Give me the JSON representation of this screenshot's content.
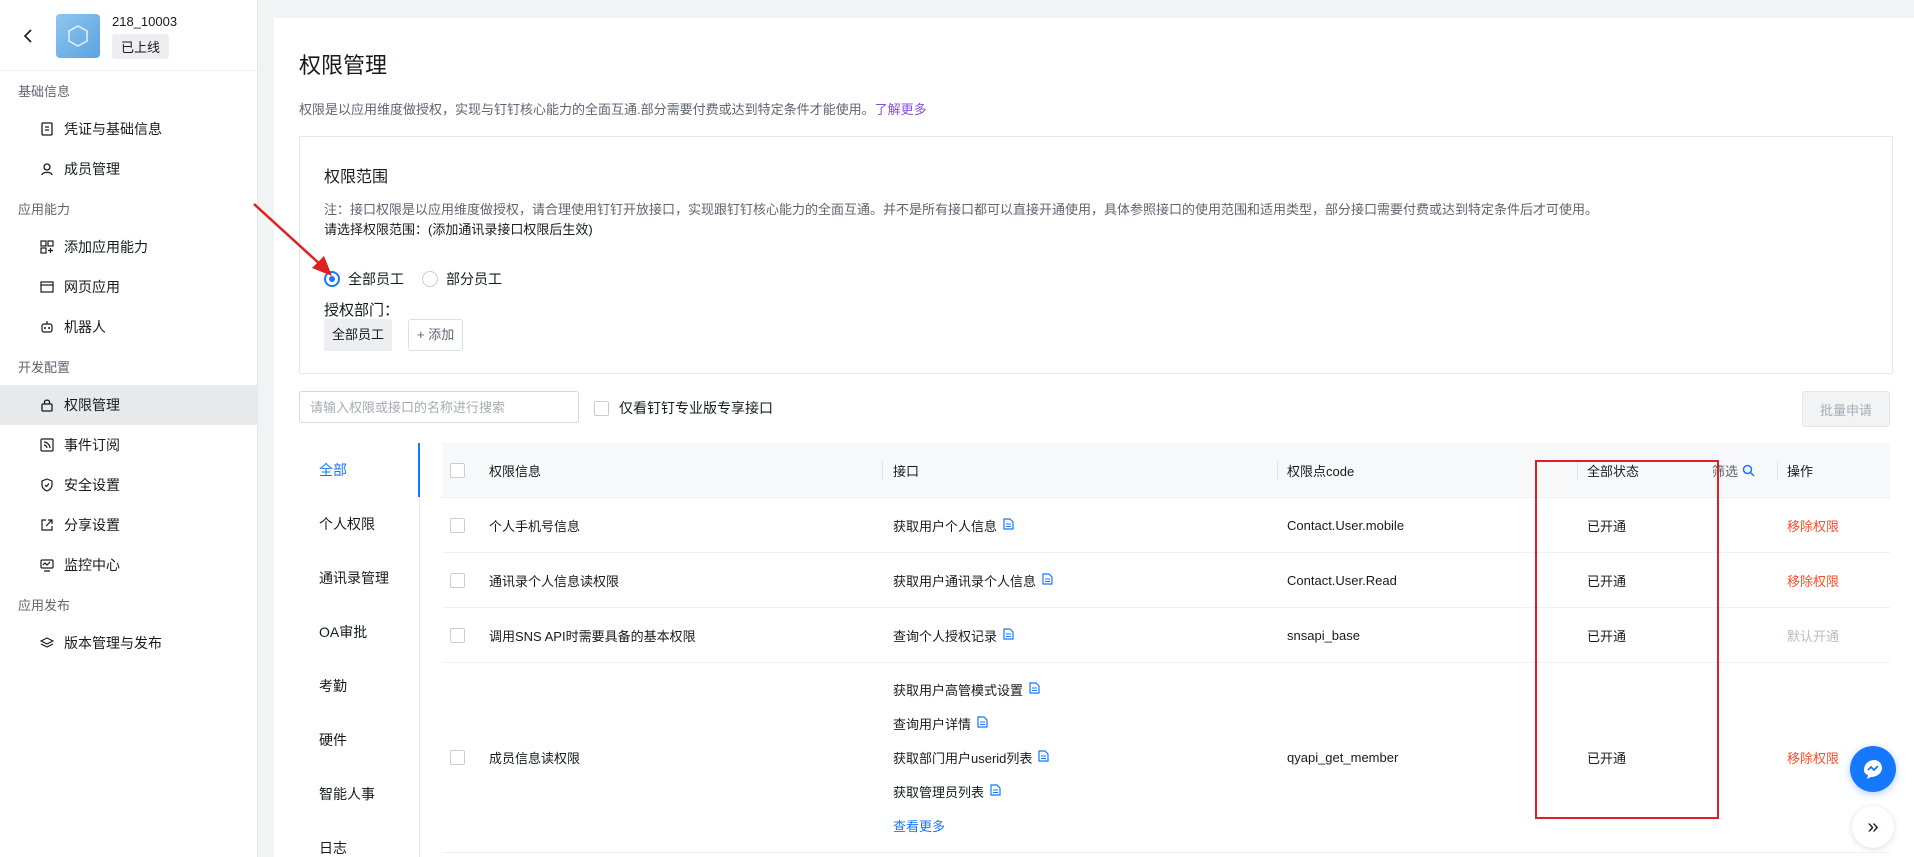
{
  "app": {
    "name": "218_10003",
    "status": "已上线"
  },
  "sidebar": {
    "groups": [
      {
        "title": "基础信息",
        "items": [
          {
            "label": "凭证与基础信息",
            "icon": "credential-icon"
          },
          {
            "label": "成员管理",
            "icon": "user-icon"
          }
        ]
      },
      {
        "title": "应用能力",
        "items": [
          {
            "label": "添加应用能力",
            "icon": "grid-plus-icon"
          },
          {
            "label": "网页应用",
            "icon": "browser-icon"
          },
          {
            "label": "机器人",
            "icon": "robot-icon"
          }
        ]
      },
      {
        "title": "开发配置",
        "items": [
          {
            "label": "权限管理",
            "icon": "lock-icon",
            "active": true
          },
          {
            "label": "事件订阅",
            "icon": "rss-icon"
          },
          {
            "label": "安全设置",
            "icon": "shield-icon"
          },
          {
            "label": "分享设置",
            "icon": "share-icon"
          },
          {
            "label": "监控中心",
            "icon": "monitor-icon"
          }
        ]
      },
      {
        "title": "应用发布",
        "items": [
          {
            "label": "版本管理与发布",
            "icon": "layers-icon"
          }
        ]
      }
    ]
  },
  "page": {
    "title": "权限管理",
    "desc": "权限是以应用维度做授权，实现与钉钉核心能力的全面互通.部分需要付费或达到特定条件才能使用。",
    "learn_more": "了解更多"
  },
  "scope": {
    "title": "权限范围",
    "note": "注：接口权限是以应用维度做授权，请合理使用钉钉开放接口，实现跟钉钉核心能力的全面互通。并不是所有接口都可以直接开通使用，具体参照接口的使用范围和适用类型，部分接口需要付费或达到特定条件后才可使用。",
    "prompt": "请选择权限范围：(添加通讯录接口权限后生效)",
    "radio_all": "全部员工",
    "radio_part": "部分员工",
    "selected": "all",
    "dept_label": "授权部门：",
    "dept_tag": "全部员工",
    "add_label": "添加"
  },
  "toolbar": {
    "search_placeholder": "请输入权限或接口的名称进行搜索",
    "pro_only": "仅看钉钉专业版专享接口",
    "batch_apply": "批量申请"
  },
  "categories": [
    "全部",
    "个人权限",
    "通讯录管理",
    "OA审批",
    "考勤",
    "硬件",
    "智能人事",
    "日志"
  ],
  "table": {
    "headers": {
      "info": "权限信息",
      "api": "接口",
      "code": "权限点code",
      "status": "全部状态",
      "filter": "筛选",
      "op": "操作"
    },
    "rows": [
      {
        "info": "个人手机号信息",
        "apis": [
          "获取用户个人信息"
        ],
        "code": "Contact.User.mobile",
        "status": "已开通",
        "op": "移除权限",
        "op_type": "remove"
      },
      {
        "info": "通讯录个人信息读权限",
        "apis": [
          "获取用户通讯录个人信息"
        ],
        "code": "Contact.User.Read",
        "status": "已开通",
        "op": "移除权限",
        "op_type": "remove"
      },
      {
        "info": "调用SNS API时需要具备的基本权限",
        "apis": [
          "查询个人授权记录"
        ],
        "code": "snsapi_base",
        "status": "已开通",
        "op": "默认开通",
        "op_type": "default"
      },
      {
        "info": "成员信息读权限",
        "apis": [
          "获取用户高管模式设置",
          "查询用户详情",
          "获取部门用户userid列表",
          "获取管理员列表"
        ],
        "more": "查看更多",
        "code": "qyapi_get_member",
        "status": "已开通",
        "op": "移除权限",
        "op_type": "remove"
      }
    ]
  },
  "colors": {
    "accent": "#1677ff",
    "danger": "#f5502b",
    "highlight": "#e02020",
    "link_purple": "#8b50d8"
  }
}
